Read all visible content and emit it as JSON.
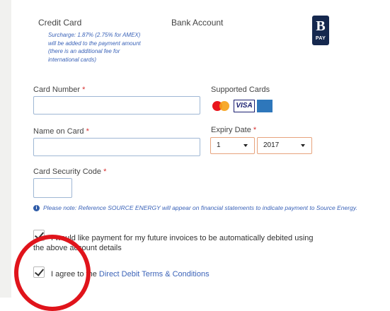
{
  "tabs": {
    "credit_card": "Credit Card",
    "bank_account": "Bank Account"
  },
  "surcharge_lines": [
    "Surcharge: 1.87% (2.75% for AMEX)",
    "will be added to the payment amount",
    "(there is an additional fee for",
    "international cards)"
  ],
  "logo": {
    "mark": "B",
    "text": "PAY"
  },
  "fields": {
    "card_number": {
      "label": "Card Number",
      "value": ""
    },
    "name_on_card": {
      "label": "Name on Card",
      "value": ""
    },
    "security_code": {
      "label": "Card Security Code",
      "value": ""
    },
    "required_mark": "*"
  },
  "supported_cards": {
    "label": "Supported Cards",
    "visa": "VISA",
    "cards": [
      "mastercard-icon",
      "visa-icon",
      "amex-icon"
    ]
  },
  "expiry": {
    "label": "Expiry Date",
    "month": "1",
    "year": "2017"
  },
  "note": "Please note: Reference SOURCE ENERGY will appear on financial statements to indicate payment to Source Energy.",
  "checkboxes": {
    "auto_debit": {
      "line1": "I would like payment for my future invoices to be automatically debited using",
      "line2": "the above account details",
      "checked": true
    },
    "agree": {
      "prefix": "I agree to the",
      "link": "Direct Debit Terms & Conditions",
      "checked": true
    }
  },
  "colors": {
    "accent": "#3b63b8",
    "required": "#d62f2f",
    "annotation": "#e0141b",
    "logo_bg": "#15284e"
  }
}
